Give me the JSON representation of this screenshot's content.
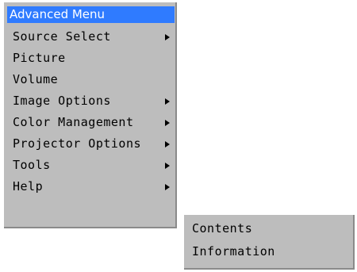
{
  "menu": {
    "title": "Advanced Menu",
    "items": [
      {
        "label": "Source Select",
        "has_submenu": true,
        "arrow_icon": "triangle-right"
      },
      {
        "label": "Picture",
        "has_submenu": false
      },
      {
        "label": "Volume",
        "has_submenu": false
      },
      {
        "label": "Image Options",
        "has_submenu": true,
        "arrow_icon": "triangle-right"
      },
      {
        "label": "Color Management",
        "has_submenu": true,
        "arrow_icon": "triangle-right"
      },
      {
        "label": "Projector Options",
        "has_submenu": true,
        "arrow_icon": "triangle-right"
      },
      {
        "label": "Tools",
        "has_submenu": true,
        "arrow_icon": "triangle-right"
      },
      {
        "label": "Help",
        "has_submenu": true,
        "arrow_icon": "triangle-right"
      }
    ]
  },
  "submenu": {
    "items": [
      {
        "label": "Contents"
      },
      {
        "label": "Information"
      }
    ]
  },
  "colors": {
    "menu_background": "#bdbdbd",
    "title_highlight": "#2f7bff",
    "title_text": "#ffffff",
    "item_text": "#000000"
  }
}
